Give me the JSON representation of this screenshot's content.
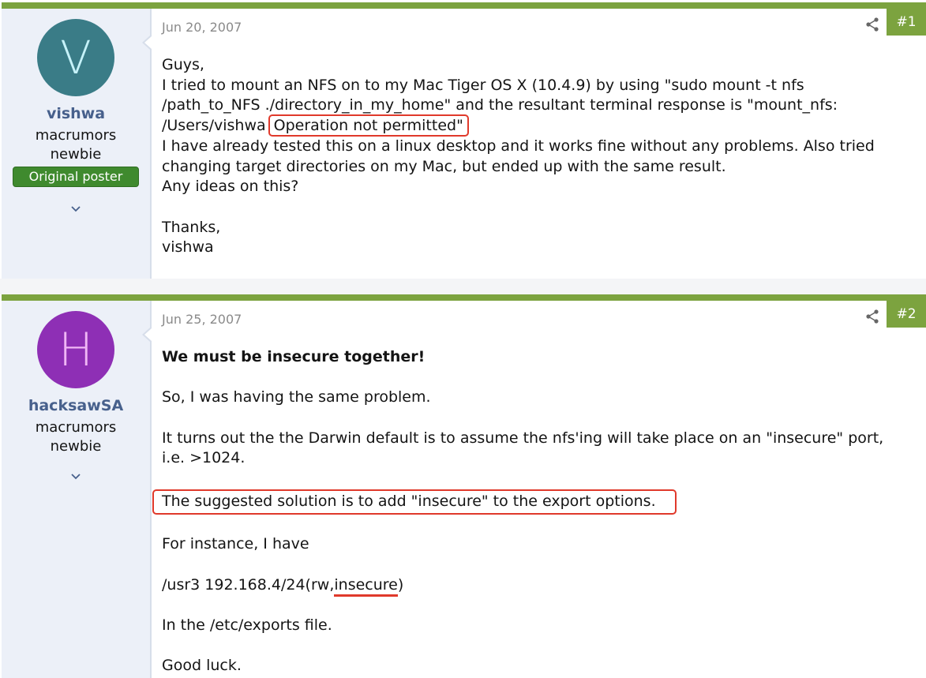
{
  "posts": [
    {
      "number": "#1",
      "date": "Jun 20, 2007",
      "author": {
        "initial": "V",
        "name": "vishwa",
        "title_line1": "macrumors",
        "title_line2": "newbie",
        "badge": "Original poster",
        "avatar_color": "#3a7c87"
      },
      "body": {
        "line1": "Guys,",
        "line2": "I tried to mount an NFS on to my Mac Tiger OS X (10.4.9) by using \"sudo mount -t nfs",
        "line3": "/path_to_NFS ./directory_in_my_home\" and the resultant terminal response is \"mount_nfs:",
        "line4_pre": "/Users/vishwa",
        "line4_highlight": "Operation not permitted\"",
        "line5": "I have already tested this on a linux desktop and it works fine without any problems. Also tried",
        "line6": "changing target directories on my Mac, but ended up with the same result.",
        "line7": "Any ideas on this?",
        "line8": "Thanks,",
        "line9": "vishwa"
      }
    },
    {
      "number": "#2",
      "date": "Jun 25, 2007",
      "author": {
        "initial": "H",
        "name": "hacksawSA",
        "title_line1": "macrumors",
        "title_line2": "newbie",
        "avatar_color": "#8e2fb5"
      },
      "body": {
        "heading": "We must be insecure together!",
        "p1": "So, I was having the same problem.",
        "p2_line1": "It turns out the the Darwin default is to assume the nfs'ing will take place on an \"insecure\" port,",
        "p2_line2": "i.e. >1024.",
        "p3_highlight": "The suggested solution is to add \"insecure\" to the export options.",
        "p4": "For instance, I have",
        "p5_pre": "/usr3 192.168.4/24(rw,",
        "p5_underline": "insecure",
        "p5_post": ")",
        "p6": "In the /etc/exports file.",
        "p7": "Good luck."
      }
    }
  ],
  "colors": {
    "accent_green": "#7ca33f",
    "badge_green": "#3f8a2e",
    "username_blue": "#47608c",
    "highlight_red": "#e0392b",
    "sidebar_bg": "#ecf0f8"
  },
  "icons": {
    "share": "share-icon",
    "expand": "chevron-down-icon"
  }
}
